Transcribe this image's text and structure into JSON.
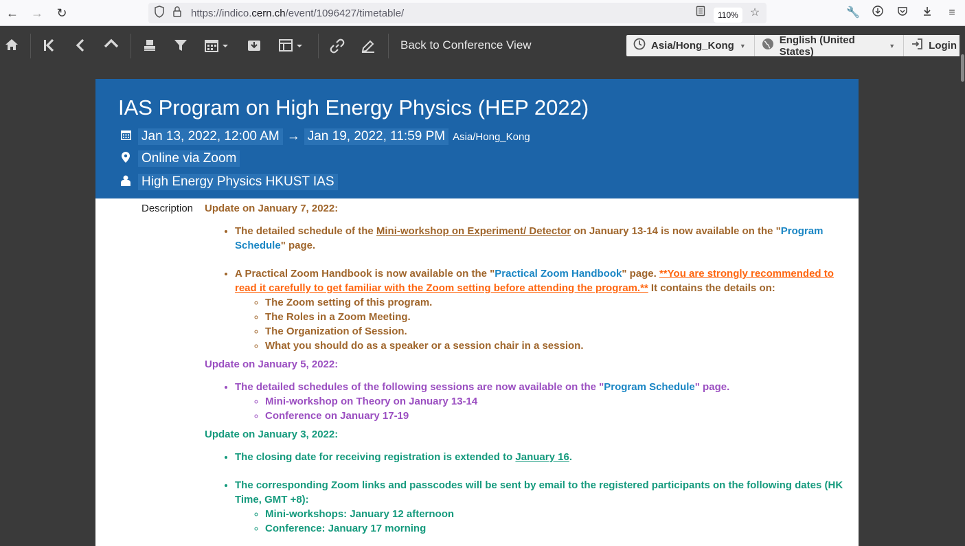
{
  "browser": {
    "url_prefix": "https://indico.",
    "url_host": "cern.ch",
    "url_suffix": "/event/1096427/timetable/",
    "zoom": "110%"
  },
  "toolbar": {
    "back_label": "Back to Conference View",
    "timezone": "Asia/Hong_Kong",
    "language": "English (United States)",
    "login": "Login"
  },
  "event": {
    "title": "IAS Program on High Energy Physics (HEP 2022)",
    "start": "Jan 13, 2022, 12:00 AM",
    "arrow": "→",
    "end": "Jan 19, 2022, 11:59 PM",
    "timezone": "Asia/Hong_Kong",
    "location": "Online via Zoom",
    "organizer": "High Energy Physics HKUST IAS"
  },
  "description": {
    "label": "Description",
    "update1": {
      "heading": "Update on January 7, 2022:",
      "item1_a": "The detailed schedule of the ",
      "item1_link": "Mini-workshop on Experiment/ Detector",
      "item1_b": " on January 13-14 is now available on the \"",
      "item1_link2": "Program Schedule",
      "item1_c": "\" page.",
      "item2_a": "A Practical Zoom Handbook is now available on the \"",
      "item2_link": "Practical Zoom Handbook",
      "item2_b": "\" page. ",
      "item2_orange": "**You are strongly recommended to read it carefully to get familiar with the Zoom setting before attending the program.**",
      "item2_c": " It contains the details on:",
      "sub": [
        "The Zoom setting of this program.",
        "The Roles in a Zoom Meeting.",
        "The Organization of Session.",
        "What you should do as a speaker or a session chair in a session."
      ]
    },
    "update2": {
      "heading": "Update on January 5, 2022:",
      "item1_a": "The detailed schedules of the following sessions are now available on the \"",
      "item1_link": "Program Schedule",
      "item1_b": "\" page.",
      "sub": [
        "Mini-workshop on Theory on January 13-14",
        "Conference on January 17-19"
      ]
    },
    "update3": {
      "heading": "Update on January 3, 2022:",
      "item1_a": "The closing date for receiving registration is extended to ",
      "item1_link": "January 16",
      "item1_b": ".",
      "item2": "The corresponding Zoom links and passcodes will be sent by email to the registered participants on the following dates (HK Time, GMT +8):",
      "sub": [
        "Mini-workshops: January 12 afternoon",
        "Conference: January 17 morning"
      ]
    }
  }
}
